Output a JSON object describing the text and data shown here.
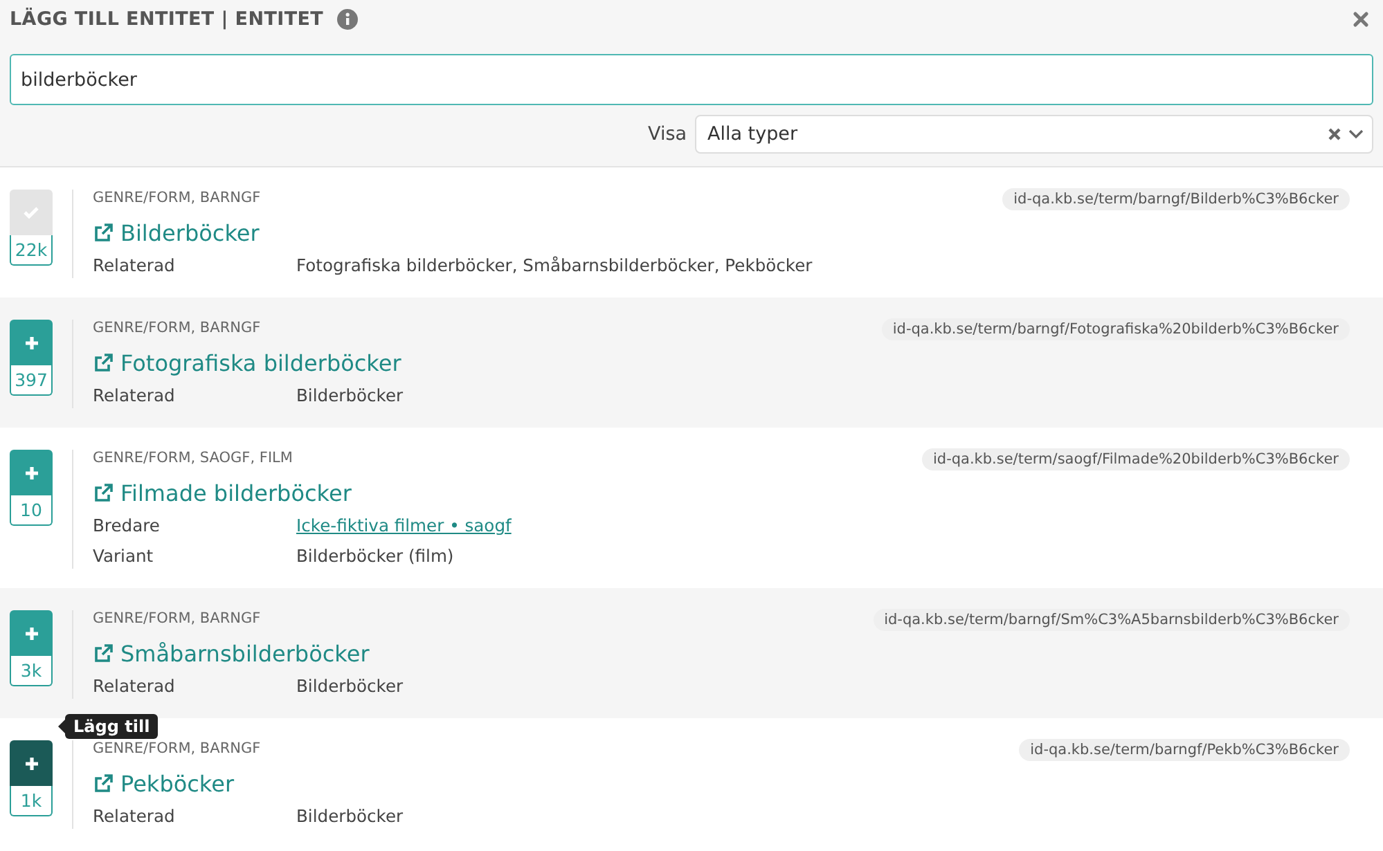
{
  "dialog": {
    "title": "LÄGG TILL ENTITET | ENTITET",
    "search": {
      "value": "bilderböcker"
    },
    "filter": {
      "label": "Visa",
      "value": "Alla typer"
    }
  },
  "results": [
    {
      "added": true,
      "hovered": false,
      "count": "22k",
      "category": "GENRE/FORM, BARNGF",
      "title": "Bilderböcker",
      "uri": "id-qa.kb.se/term/barngf/Bilderb%C3%B6cker",
      "properties": [
        {
          "label": "Relaterad",
          "value": "Fotografiska bilderböcker, Småbarnsbilderböcker, Pekböcker",
          "kind": "text"
        }
      ]
    },
    {
      "added": false,
      "hovered": false,
      "count": "397",
      "category": "GENRE/FORM, BARNGF",
      "title": "Fotografiska bilderböcker",
      "uri": "id-qa.kb.se/term/barngf/Fotografiska%20bilderb%C3%B6cker",
      "properties": [
        {
          "label": "Relaterad",
          "value": "Bilderböcker",
          "kind": "text"
        }
      ]
    },
    {
      "added": false,
      "hovered": false,
      "count": "10",
      "category": "GENRE/FORM, SAOGF, FILM",
      "title": "Filmade bilderböcker",
      "uri": "id-qa.kb.se/term/saogf/Filmade%20bilderb%C3%B6cker",
      "properties": [
        {
          "label": "Bredare",
          "value": "Icke-fiktiva filmer • saogf",
          "kind": "link"
        },
        {
          "label": "Variant",
          "value": "Bilderböcker (film)",
          "kind": "text"
        }
      ]
    },
    {
      "added": false,
      "hovered": false,
      "count": "3k",
      "category": "GENRE/FORM, BARNGF",
      "title": "Småbarnsbilderböcker",
      "uri": "id-qa.kb.se/term/barngf/Sm%C3%A5barnsbilderb%C3%B6cker",
      "properties": [
        {
          "label": "Relaterad",
          "value": "Bilderböcker",
          "kind": "text"
        }
      ]
    },
    {
      "added": false,
      "hovered": true,
      "tooltip": "Lägg till",
      "count": "1k",
      "category": "GENRE/FORM, BARNGF",
      "title": "Pekböcker",
      "uri": "id-qa.kb.se/term/barngf/Pekb%C3%B6cker",
      "properties": [
        {
          "label": "Relaterad",
          "value": "Bilderböcker",
          "kind": "text"
        }
      ]
    }
  ]
}
